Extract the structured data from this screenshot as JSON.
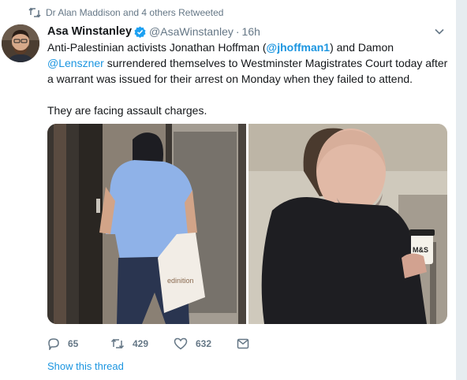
{
  "retweet_context": {
    "text": "Dr Alan Maddison and 4 others Retweeted"
  },
  "tweet": {
    "author_name": "Asa Winstanley",
    "author_handle": "@AsaWinstanley",
    "separator": "·",
    "time": "16h",
    "text_before_mention1": "Anti-Palestinian activists Jonathan Hoffman (",
    "mention1": "@jhoffman1",
    "text_between": ") and Damon ",
    "mention2": "@Lenszner",
    "text_after": " surrendered themselves to Westminster Magistrates Court today after a warrant was issued for their arrest on Monday when they failed to attend.",
    "second_paragraph": "They are facing assault charges."
  },
  "media": {
    "left_bag_text": "edinition",
    "right_cup_text": "M&S"
  },
  "actions": {
    "reply_count": "65",
    "retweet_count": "429",
    "like_count": "632"
  },
  "show_thread_label": "Show this thread",
  "colors": {
    "accent": "#1b95e0",
    "secondary_text": "#657786",
    "verified": "#1da1f2"
  },
  "icons": [
    "retweet-icon",
    "verified-badge-icon",
    "chevron-down-icon",
    "reply-icon",
    "retweet-icon",
    "like-icon",
    "direct-message-icon"
  ]
}
